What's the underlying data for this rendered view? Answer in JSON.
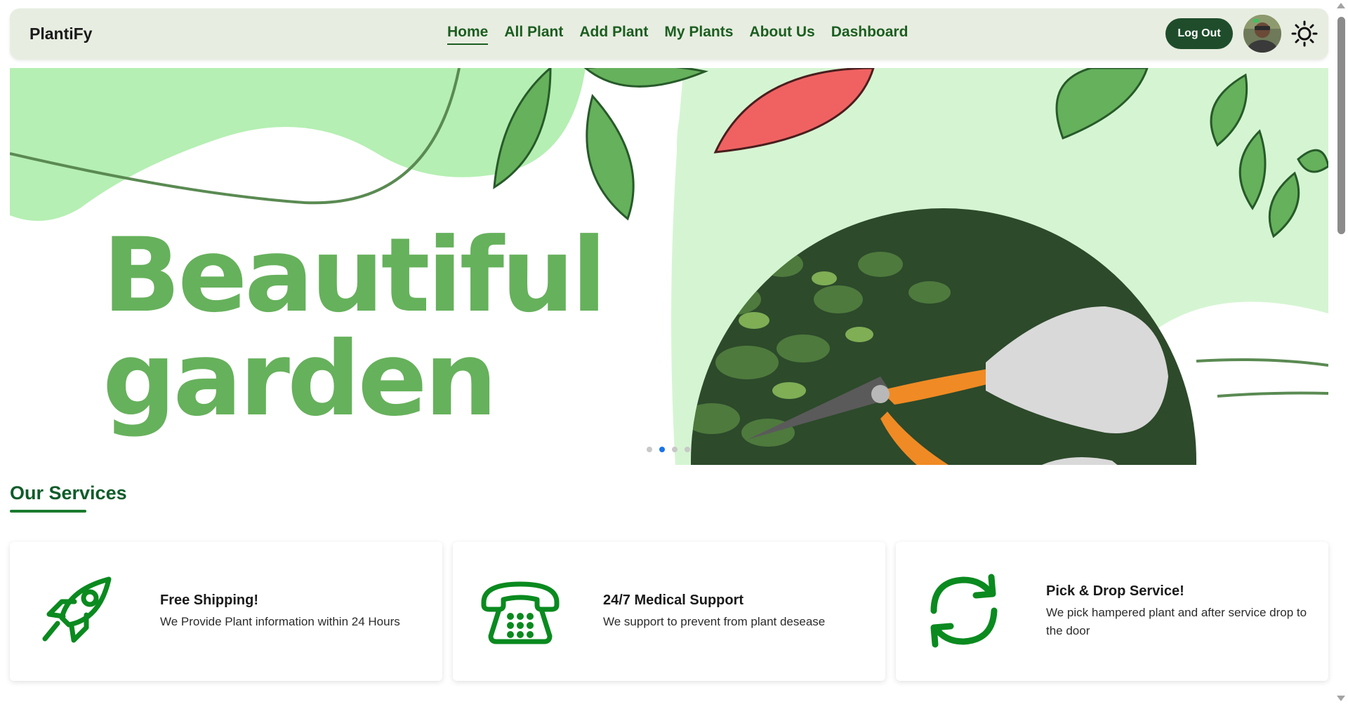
{
  "navbar": {
    "brand": "PlantiFy",
    "links": [
      {
        "label": "Home",
        "active": true
      },
      {
        "label": "All Plant",
        "active": false
      },
      {
        "label": "Add Plant",
        "active": false
      },
      {
        "label": "My Plants",
        "active": false
      },
      {
        "label": "About Us",
        "active": false
      },
      {
        "label": "Dashboard",
        "active": false
      }
    ],
    "logout_label": "Log Out",
    "avatar_icon": "user-avatar",
    "theme_icon": "sun-icon"
  },
  "hero": {
    "headline_line1": "Beautiful",
    "headline_line2": "garden",
    "slides": 4,
    "active_slide": 2,
    "image": "hands-pruning-plant-icon"
  },
  "services": {
    "title": "Our Services",
    "items": [
      {
        "icon": "rocket-icon",
        "title": "Free Shipping!",
        "desc": "We Provide Plant information within 24 Hours"
      },
      {
        "icon": "telephone-icon",
        "title": "24/7 Medical Support",
        "desc": "We support to prevent from plant desease"
      },
      {
        "icon": "refresh-icon",
        "title": "Pick & Drop Service!",
        "desc": "We pick hampered plant and after service drop to the door"
      }
    ]
  },
  "colors": {
    "nav_bg": "#e8ede1",
    "brand_green": "#1b5e20",
    "hero_green": "#66b15c",
    "icon_green": "#0a8a1f"
  }
}
